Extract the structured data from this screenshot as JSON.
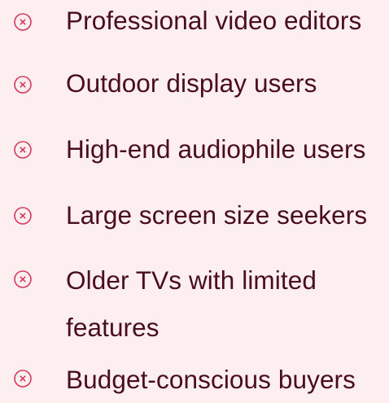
{
  "theme": {
    "background": "#fdeeef",
    "text_color": "#4a0d1c",
    "icon_color": "#d23b5d"
  },
  "list": {
    "items": [
      {
        "icon": "close-circle-icon",
        "label": "Professional video editors"
      },
      {
        "icon": "close-circle-icon",
        "label": "Outdoor display users"
      },
      {
        "icon": "close-circle-icon",
        "label": "High-end audiophile users"
      },
      {
        "icon": "close-circle-icon",
        "label": "Large screen size seekers"
      },
      {
        "icon": "close-circle-icon",
        "label": "Older TVs with limited features"
      },
      {
        "icon": "close-circle-icon",
        "label": "Budget-conscious buyers"
      }
    ]
  }
}
